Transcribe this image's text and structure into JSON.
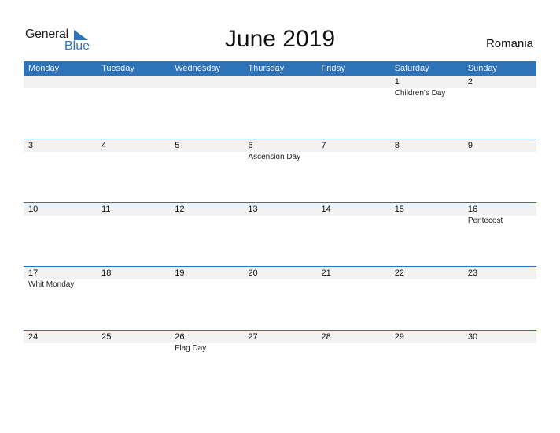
{
  "logo": {
    "line1": "General",
    "line2": "Blue"
  },
  "title": "June 2019",
  "country": "Romania",
  "weekdays": [
    "Monday",
    "Tuesday",
    "Wednesday",
    "Thursday",
    "Friday",
    "Saturday",
    "Sunday"
  ],
  "weeks": [
    [
      {
        "d": "",
        "h": ""
      },
      {
        "d": "",
        "h": ""
      },
      {
        "d": "",
        "h": ""
      },
      {
        "d": "",
        "h": ""
      },
      {
        "d": "",
        "h": ""
      },
      {
        "d": "1",
        "h": "Children's Day"
      },
      {
        "d": "2",
        "h": ""
      }
    ],
    [
      {
        "d": "3",
        "h": ""
      },
      {
        "d": "4",
        "h": ""
      },
      {
        "d": "5",
        "h": ""
      },
      {
        "d": "6",
        "h": "Ascension Day"
      },
      {
        "d": "7",
        "h": ""
      },
      {
        "d": "8",
        "h": ""
      },
      {
        "d": "9",
        "h": ""
      }
    ],
    [
      {
        "d": "10",
        "h": ""
      },
      {
        "d": "11",
        "h": ""
      },
      {
        "d": "12",
        "h": ""
      },
      {
        "d": "13",
        "h": ""
      },
      {
        "d": "14",
        "h": ""
      },
      {
        "d": "15",
        "h": ""
      },
      {
        "d": "16",
        "h": "Pentecost"
      }
    ],
    [
      {
        "d": "17",
        "h": "Whit Monday"
      },
      {
        "d": "18",
        "h": ""
      },
      {
        "d": "19",
        "h": ""
      },
      {
        "d": "20",
        "h": ""
      },
      {
        "d": "21",
        "h": ""
      },
      {
        "d": "22",
        "h": ""
      },
      {
        "d": "23",
        "h": ""
      }
    ],
    [
      {
        "d": "24",
        "h": ""
      },
      {
        "d": "25",
        "h": ""
      },
      {
        "d": "26",
        "h": "Flag Day"
      },
      {
        "d": "27",
        "h": ""
      },
      {
        "d": "28",
        "h": ""
      },
      {
        "d": "29",
        "h": ""
      },
      {
        "d": "30",
        "h": ""
      }
    ]
  ],
  "colors": {
    "accent": "#2e73b8",
    "band": "#f2f2f2"
  }
}
